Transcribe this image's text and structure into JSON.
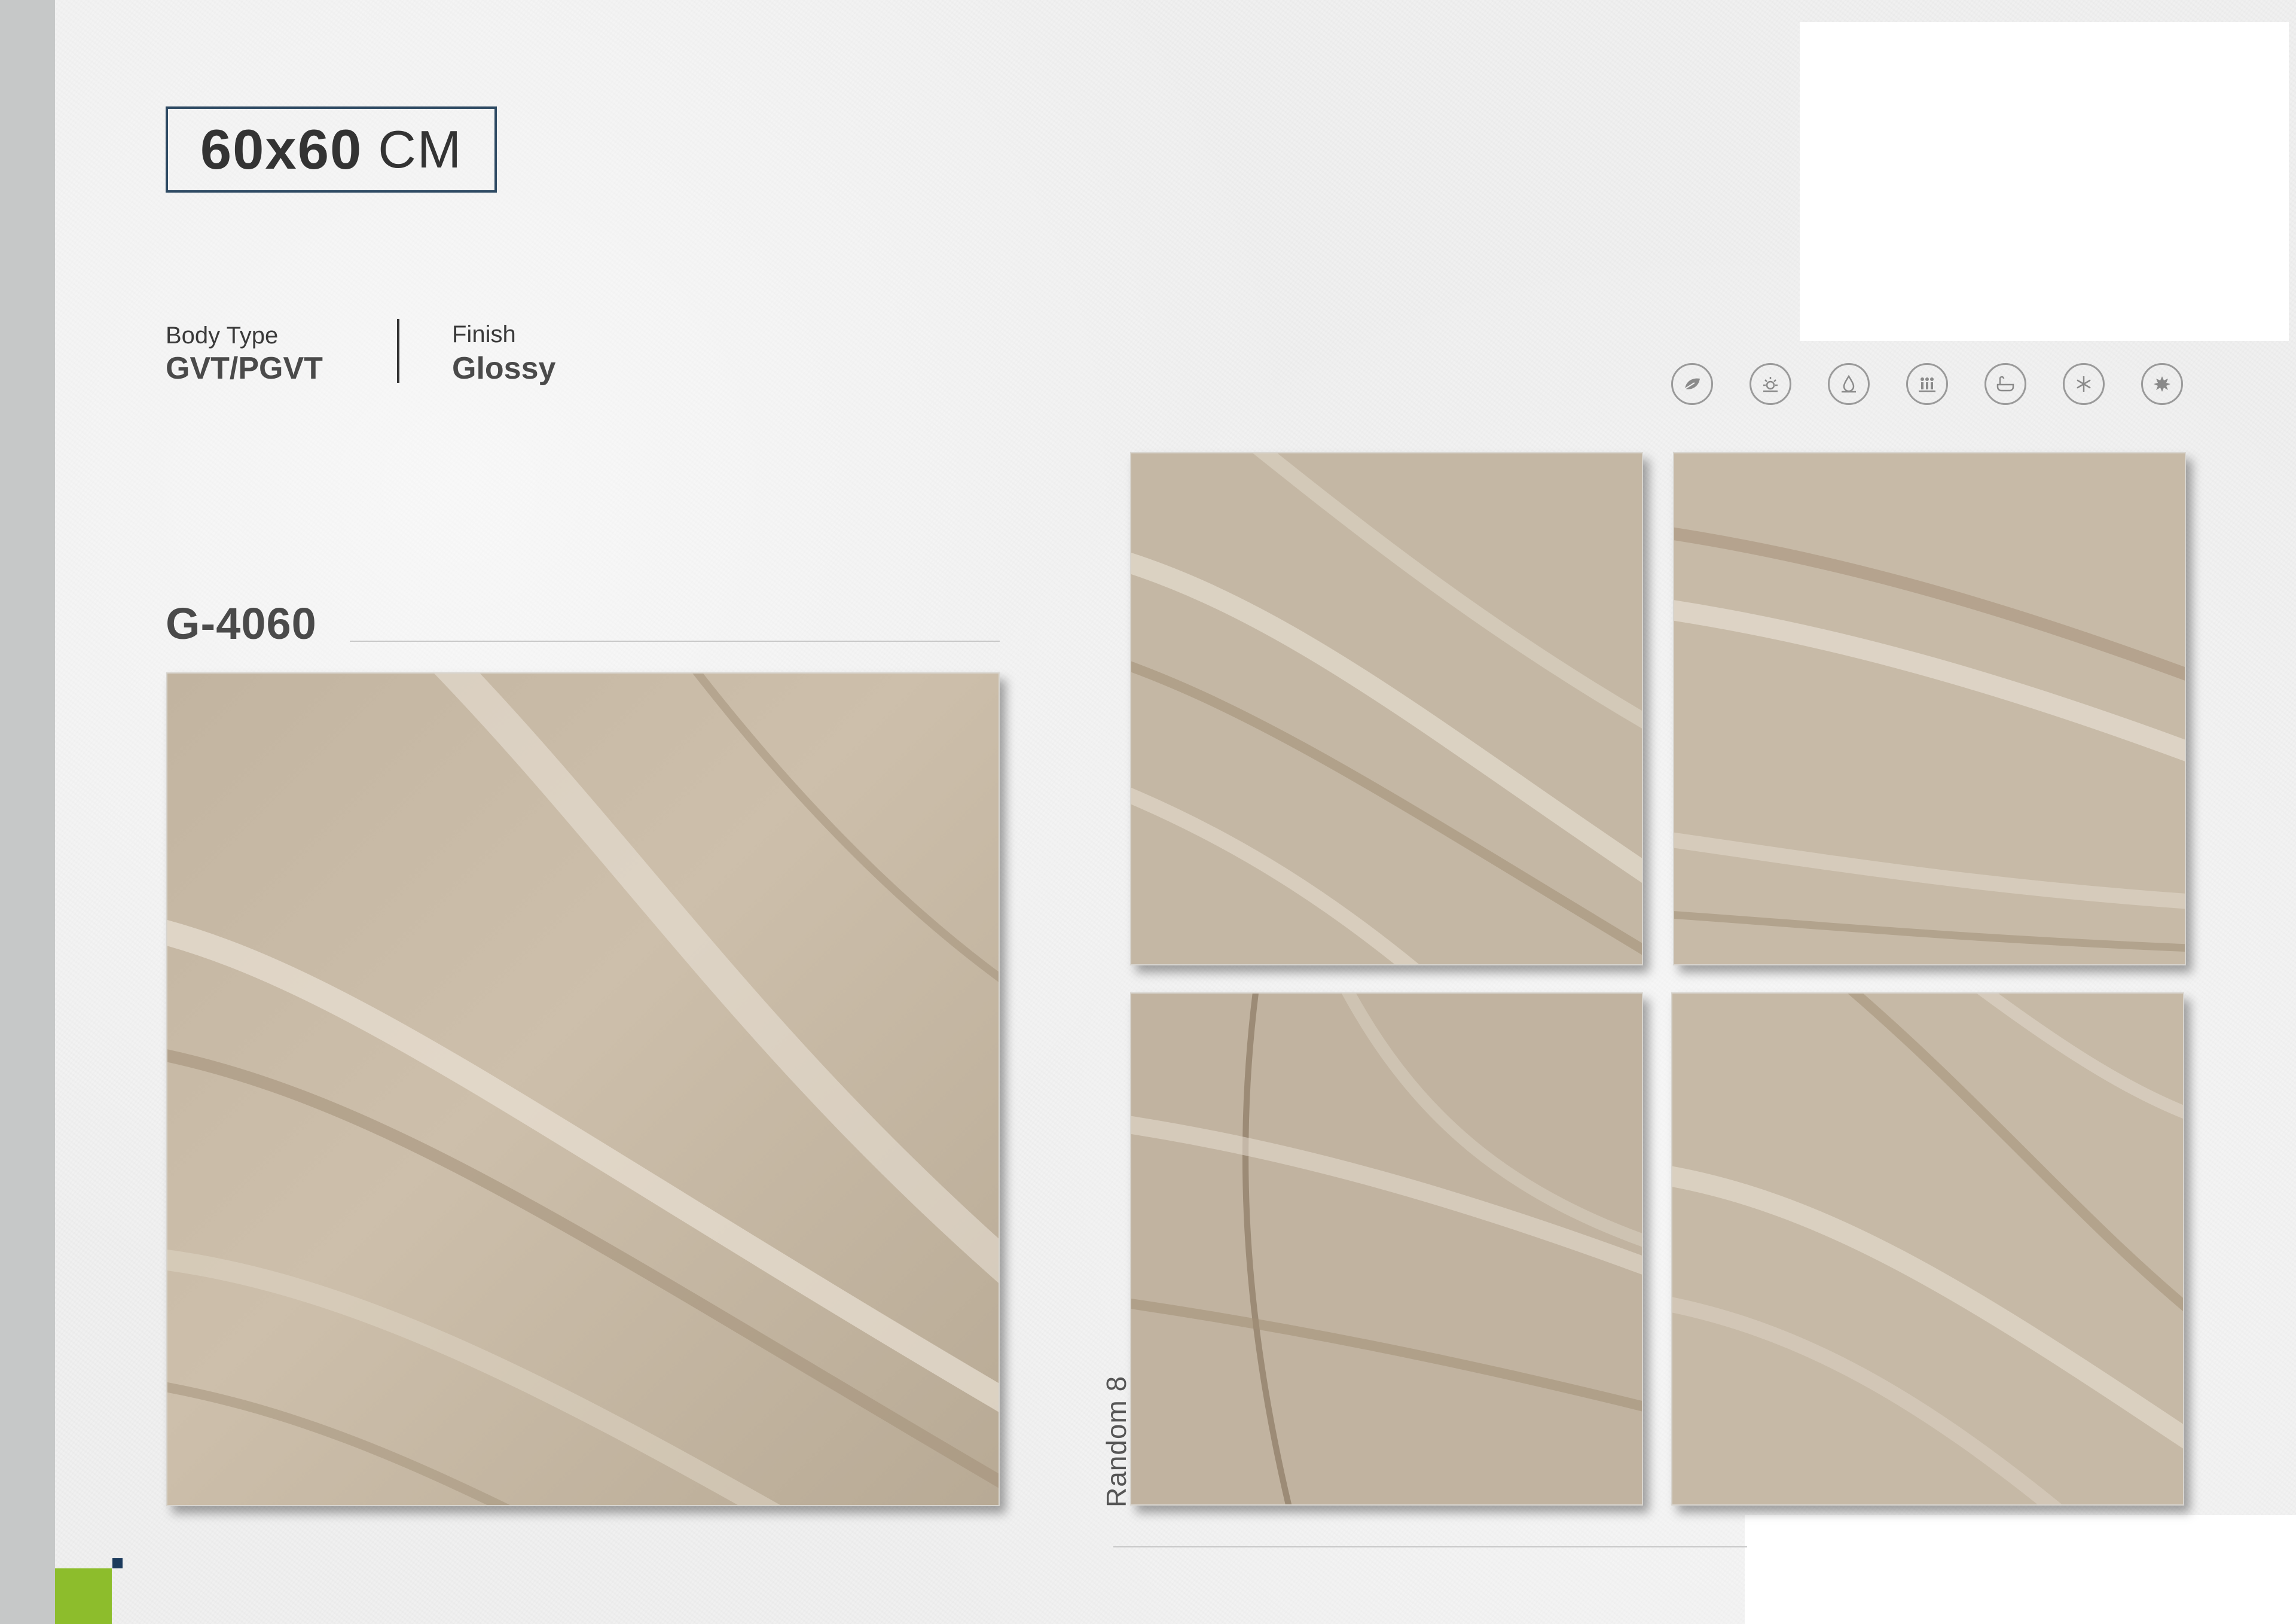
{
  "header": {
    "size_value": "60x60",
    "size_unit": "CM"
  },
  "specs": {
    "body_type_label": "Body Type",
    "body_type_value": "GVT/PGVT",
    "finish_label": "Finish",
    "finish_value": "Glossy"
  },
  "product": {
    "code": "G-4060",
    "variation_label": "Random 8"
  },
  "feature_icons": [
    "leaf-icon",
    "sun-icon",
    "water-drop-icon",
    "people-icon",
    "bathtub-icon",
    "snowflake-icon",
    "fire-burst-icon"
  ],
  "colors": {
    "accent_green": "#8dbd2c",
    "accent_navy": "#1b3a5c",
    "side_bar": "#c6c8c8",
    "tile_base": "#c9bca9"
  }
}
